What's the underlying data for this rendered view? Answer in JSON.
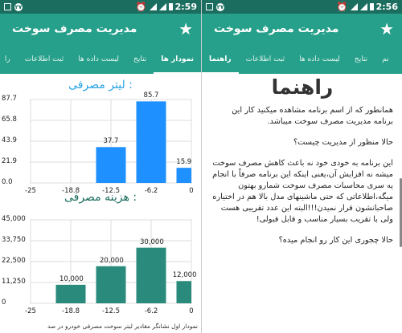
{
  "screens": {
    "left": {
      "status": {
        "time": "2:59",
        "badge": "٢٧"
      },
      "app_title": "مدیریت مصرف سوخت",
      "tabs": [
        {
          "label": "نمودار ها",
          "active": true
        },
        {
          "label": "نتایج",
          "active": false
        },
        {
          "label": "لیست داده ها",
          "active": false
        },
        {
          "label": "ثبت اطلاعات",
          "active": false
        },
        {
          "label": "را",
          "active": false
        }
      ],
      "chart1_title": "لیتر مصرفی :",
      "chart2_title": "هزینه مصرفی :",
      "footnote": "نمودار اول نشانگر مقادیر لیتر سوخت مصرفی خودرو در صد"
    },
    "right": {
      "status": {
        "time": "2:56",
        "badge": "٢٧"
      },
      "app_title": "مدیریت مصرف سوخت",
      "tabs": [
        {
          "label": "راهنما",
          "active": true
        },
        {
          "label": "ثبت اطلاعات",
          "active": false
        },
        {
          "label": "لیست داده ها",
          "active": false
        },
        {
          "label": "نتایج",
          "active": false
        },
        {
          "label": "نم",
          "active": false
        }
      ],
      "guide": {
        "heading": "راهنما",
        "paragraphs": [
          "همانطور که از اسم برنامه مشاهده میکنید کار این برنامه مدیریت مصرف سوخت میباشد.",
          "حالا منظور از مدیریت چیست؟",
          "این برنامه به خودی خود نه باعث کاهش مصرف سوخت میشه نه افزایش آن،یعنی اینکه این برنامه صرفاً با انجام یه سری محاسبات مصرف سوخت شمارو بهتون میگه،اطلاعاتی که حتی ماشینهای مدل بالا هم در اختیاره صاحبانشون قرار نمیدن!!!البته این عدد تقریبی هست ولی با تقریب بسیار مناسب و قابل قبولی!",
          "حالا چجوری این کار رو انجام میده؟"
        ]
      }
    }
  },
  "chart_data": [
    {
      "type": "bar",
      "title": "لیتر مصرفی :",
      "categories": [
        -25,
        -18.8,
        -12.5,
        -6.2,
        0
      ],
      "values": [
        0,
        0,
        37.7,
        85.7,
        15.9
      ],
      "data_labels": [
        "",
        "",
        "37.7",
        "85.7",
        "15.9"
      ],
      "y_ticks": [
        "87.7",
        "65.8",
        "43.9",
        "21.9",
        "0.0"
      ],
      "x_ticks": [
        "-25",
        "-18.8",
        "-12.5",
        "-6.2",
        "0"
      ],
      "ylim": [
        0,
        87.7
      ],
      "color": "#1e90ff",
      "grid": true
    },
    {
      "type": "bar",
      "title": "هزینه مصرفی :",
      "categories": [
        -25,
        -18.8,
        -12.5,
        -6.2,
        0
      ],
      "values": [
        0,
        10000,
        20000,
        30000,
        12000
      ],
      "data_labels": [
        "",
        "10,000",
        "20,000",
        "30,000",
        "12,000"
      ],
      "y_ticks": [
        "45,000",
        "33,750",
        "22,500",
        "11,250",
        "0"
      ],
      "x_ticks": [
        "-25",
        "-18.8",
        "-12.5",
        "-6.2",
        "0"
      ],
      "ylim": [
        0,
        45000
      ],
      "color": "#2a8a7c",
      "grid": true
    }
  ]
}
